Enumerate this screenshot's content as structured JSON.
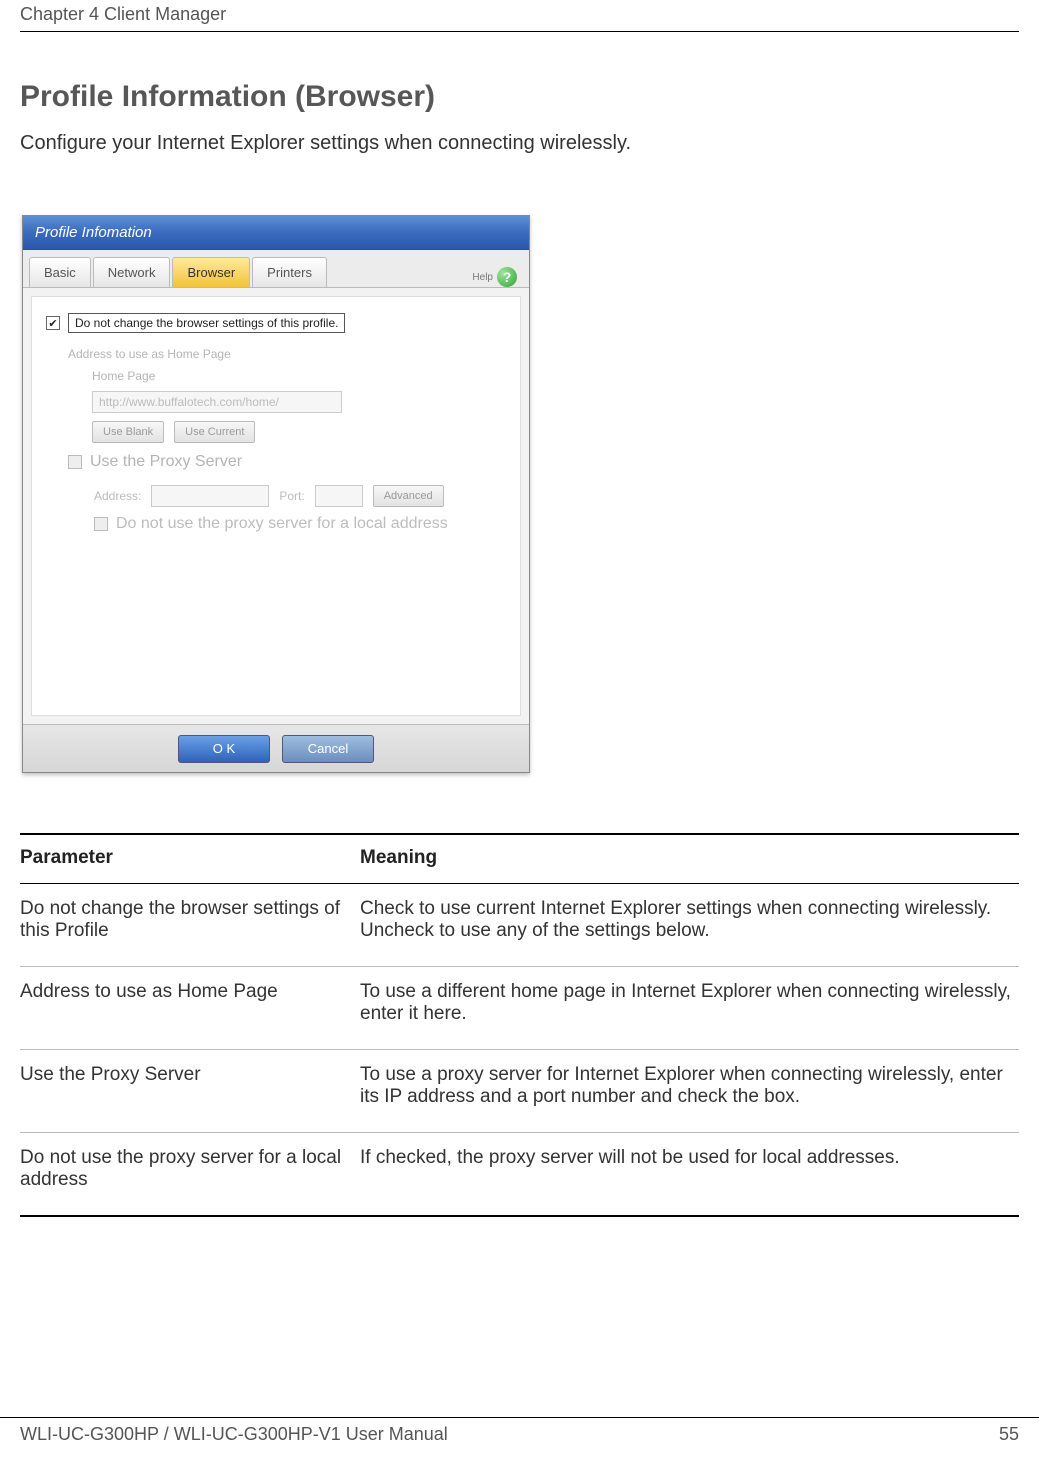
{
  "header": {
    "chapter": "Chapter 4  Client Manager"
  },
  "section": {
    "title": "Profile Information (Browser)",
    "intro": "Configure your Internet Explorer settings when connecting wirelessly."
  },
  "dialog": {
    "title": "Profile Infomation",
    "tabs": {
      "basic": "Basic",
      "network": "Network",
      "browser": "Browser",
      "printers": "Printers"
    },
    "help_label": "Help",
    "dont_change_label": "Do not change the browser settings of this profile.",
    "home_group_label": "Address to use as Home Page",
    "home_page_label": "Home Page",
    "home_page_value": "http://www.buffalotech.com/home/",
    "use_blank_btn": "Use Blank",
    "use_current_btn": "Use Current",
    "use_proxy_label": "Use the Proxy Server",
    "address_label": "Address:",
    "port_label": "Port:",
    "advanced_btn": "Advanced",
    "no_proxy_local_label": "Do not use the proxy server for a local address",
    "ok_btn": "O K",
    "cancel_btn": "Cancel"
  },
  "table": {
    "header_param": "Parameter",
    "header_meaning": "Meaning",
    "rows": [
      {
        "param": "Do not change the browser settings of this Profile",
        "meaning": "Check to use current Internet Explorer settings when connecting wirelessly.  Uncheck to use any of the settings below."
      },
      {
        "param": "Address to use as Home Page",
        "meaning": "To use a different home page in Internet Explorer when connecting wirelessly, enter it here."
      },
      {
        "param": "Use the Proxy Server",
        "meaning": "To use a proxy server for Internet Explorer when connecting wirelessly, enter its IP address and a port number and check the box."
      },
      {
        "param": "Do not use the proxy server for a local address",
        "meaning": "If checked, the proxy server will not be used for local addresses."
      }
    ]
  },
  "footer": {
    "manual": "WLI-UC-G300HP / WLI-UC-G300HP-V1 User Manual",
    "page": "55"
  }
}
